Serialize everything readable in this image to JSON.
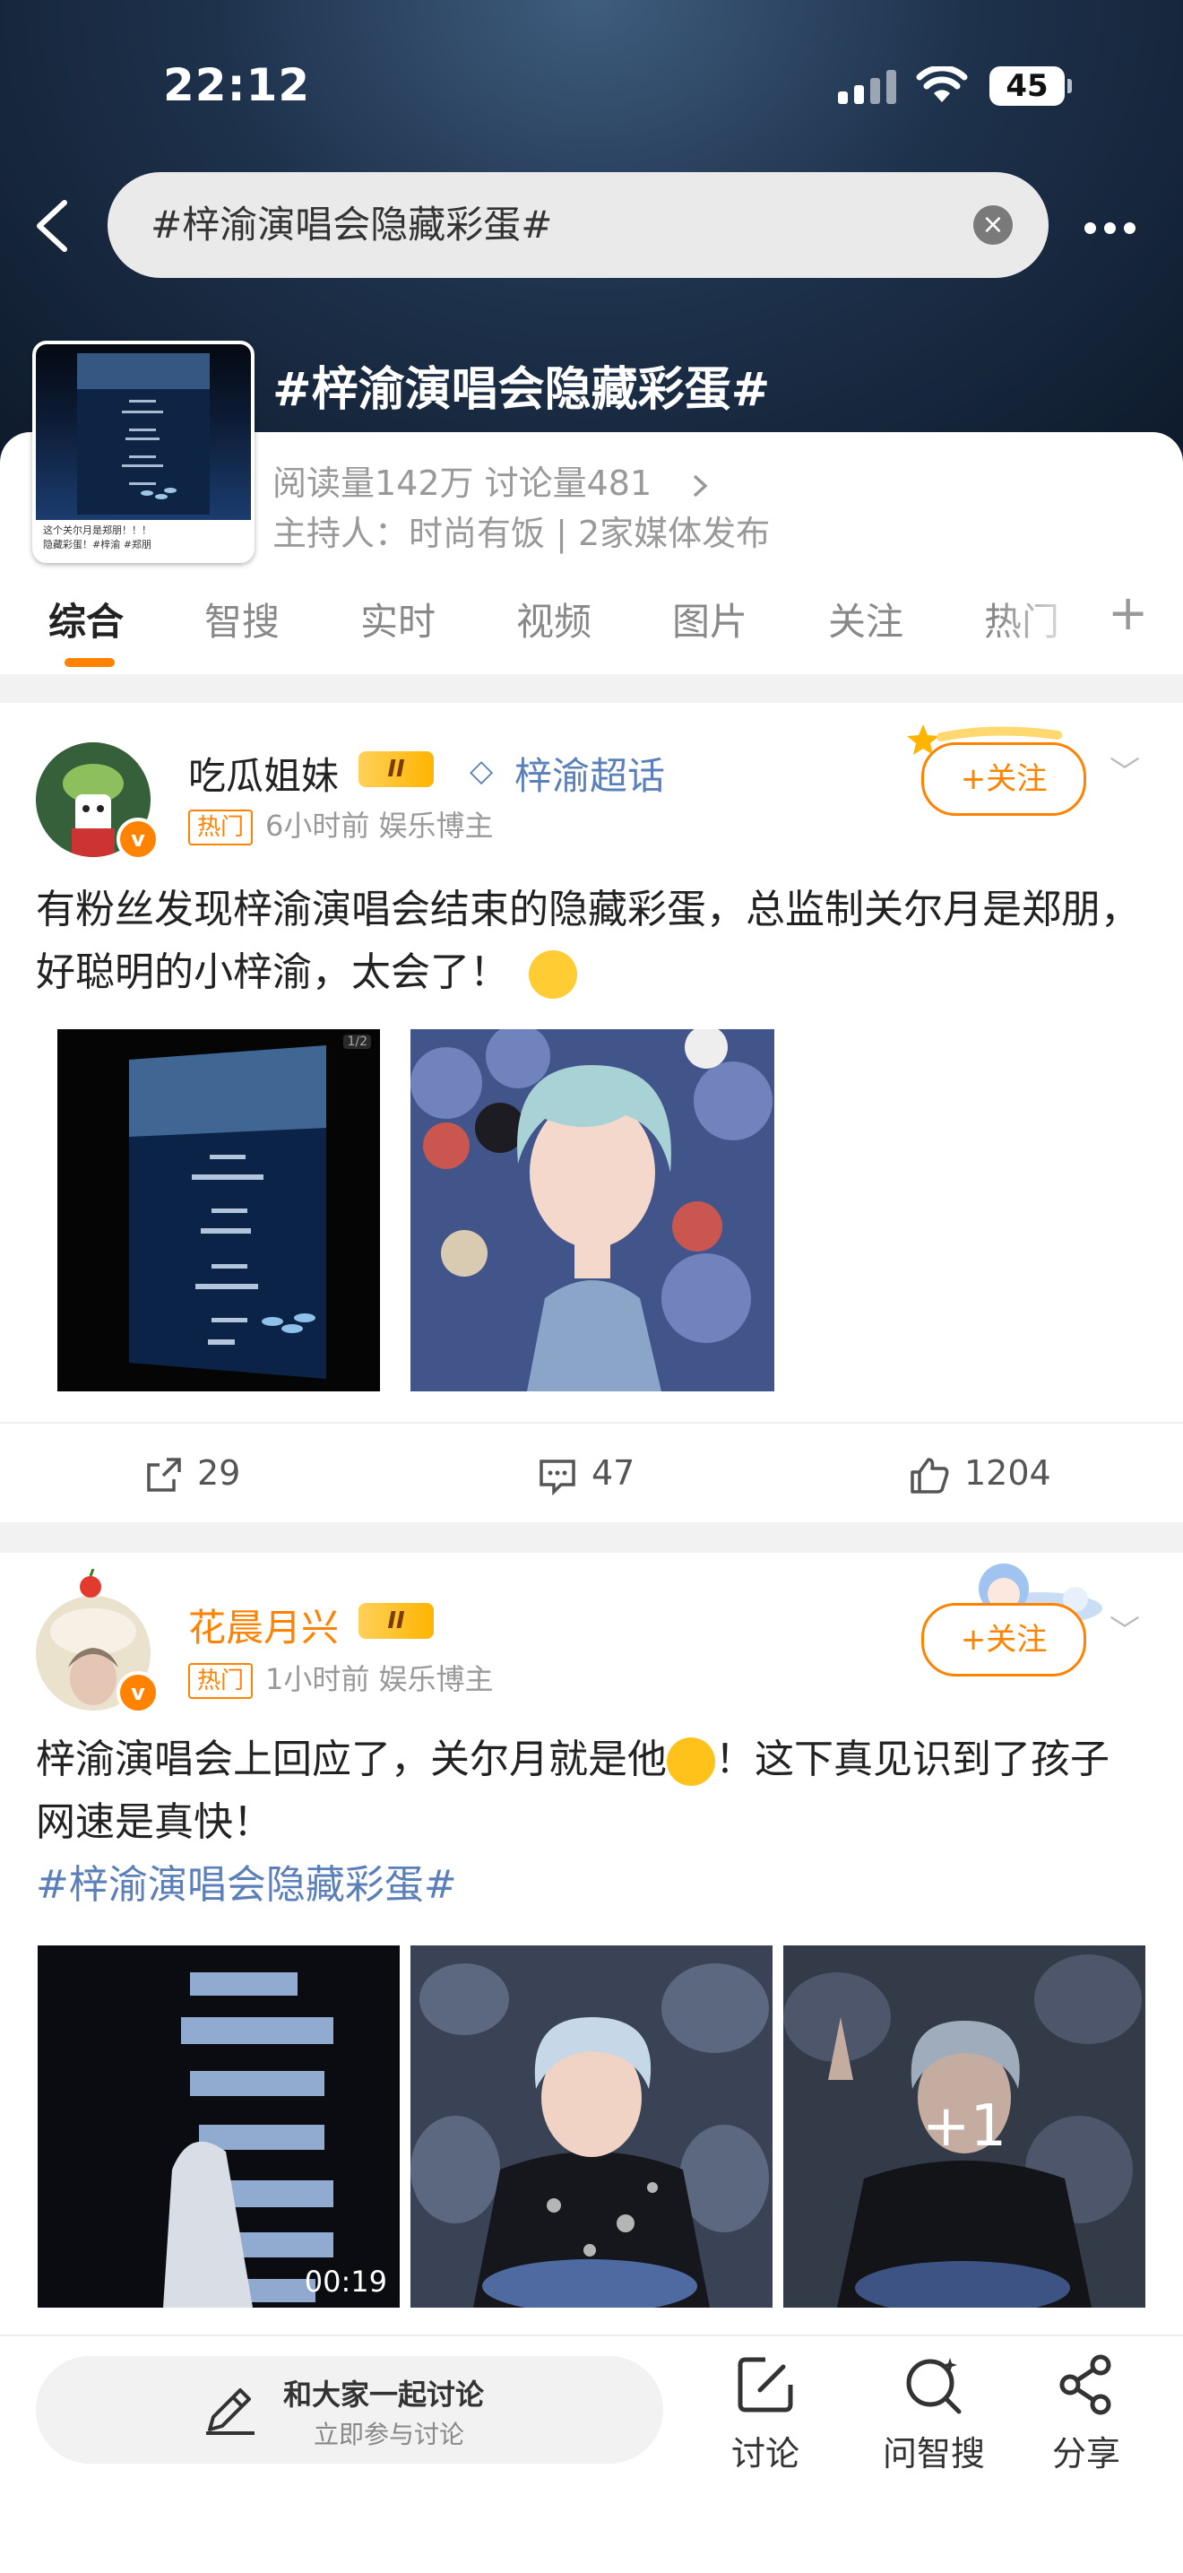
{
  "status": {
    "time": "22:12",
    "battery": "45"
  },
  "search": {
    "query": "#梓渝演唱会隐藏彩蛋#"
  },
  "topic": {
    "title": "#梓渝演唱会隐藏彩蛋#",
    "stats": "阅读量142万  讨论量481",
    "host": "主持人：时尚有饭 | 2家媒体发布",
    "thumb_caption": "这个关尔月是郑朋！！！\n隐藏彩蛋！#梓渝 #郑朋"
  },
  "tabs": [
    "综合",
    "智搜",
    "实时",
    "视频",
    "图片",
    "关注",
    "热门"
  ],
  "posts": [
    {
      "username": "吃瓜姐妹",
      "rank": "II",
      "super_topic": "梓渝超话",
      "hot_tag": "热门",
      "meta": "6小时前  娱乐博主",
      "follow": "+关注",
      "text": "有粉丝发现梓渝演唱会结束的隐藏彩蛋，总监制关尔月是郑朋，好聪明的小梓渝，太会了！",
      "image_counter": "1/2",
      "reposts": "29",
      "comments": "47",
      "likes": "1204"
    },
    {
      "username": "花晨月兴",
      "rank": "II",
      "hot_tag": "热门",
      "meta": "1小时前  娱乐博主",
      "follow": "+关注",
      "text": "梓渝演唱会上回应了，关尔月就是他",
      "text2": "！这下真见识到了孩子网速是真快！",
      "hashtag": "#梓渝演唱会隐藏彩蛋#",
      "video_duration": "00:19",
      "more_images": "+1"
    }
  ],
  "bottom": {
    "compose_main": "和大家一起讨论",
    "compose_sub": "立即参与讨论",
    "discuss": "讨论",
    "ask": "问智搜",
    "share": "分享"
  }
}
